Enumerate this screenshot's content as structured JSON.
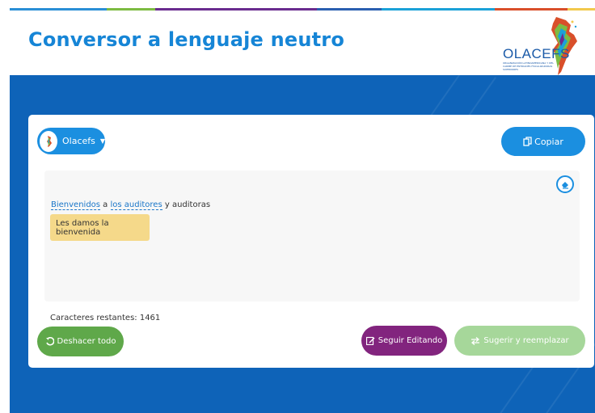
{
  "app": {
    "title": "Conversor a lenguaje neutro"
  },
  "brand": {
    "logo_text": "OLACEFS",
    "logo_subtext": "ORGANIZACIÓN LATINOAMERICANA Y DEL CARIBE DE ENTIDADES FISCALIZADORAS SUPERIORES",
    "stripe_colors": [
      "#2a8fd6",
      "#7dbb42",
      "#6a2c8f",
      "#2a5fb0",
      "#1ba1d8",
      "#d94f2a",
      "#f2c94c"
    ]
  },
  "toolbar": {
    "org_selector_label": "Olacefs",
    "copy_label": "Copiar"
  },
  "editor": {
    "sentence": {
      "word1": "Bienvenidos",
      "sep1": " a ",
      "word2": "los auditores",
      "rest": " y auditoras"
    },
    "suggestion": "Les damos la bienvenida"
  },
  "status": {
    "chars_remaining": "Caracteres restantes: 1461"
  },
  "actions": {
    "undo_label": "Deshacer todo",
    "keep_editing_label": "Seguir Editando",
    "suggest_replace_label": "Sugerir y reemplazar"
  },
  "colors": {
    "primary": "#1b8fe0",
    "background_blue": "#0e63b8",
    "title_blue": "#1685d6",
    "green": "#5fa84a",
    "purple": "#82247e",
    "light_green": "#a6d79a",
    "highlight_yellow": "#f5d98a"
  },
  "icons": {
    "org": "olacefs-logo-icon",
    "copy": "copy-icon",
    "eraser": "eraser-icon",
    "undo": "undo-icon",
    "edit": "edit-icon",
    "swap": "swap-arrows-icon"
  }
}
